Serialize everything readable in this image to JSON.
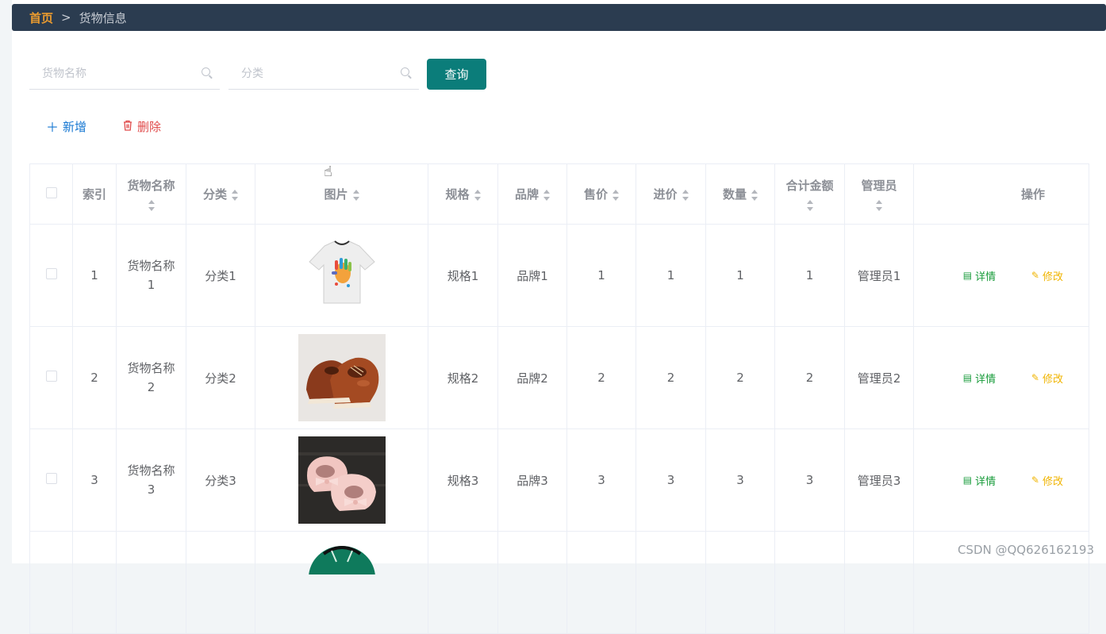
{
  "breadcrumb": {
    "home": "首页",
    "separator": ">",
    "current": "货物信息"
  },
  "search": {
    "name_placeholder": "货物名称",
    "category_placeholder": "分类",
    "query_label": "查询"
  },
  "toolbar": {
    "add_label": "新增",
    "delete_label": "删除"
  },
  "table": {
    "headers": {
      "index": "索引",
      "name": "货物名称",
      "category": "分类",
      "image": "图片",
      "spec": "规格",
      "brand": "品牌",
      "sale_price": "售价",
      "purchase_price": "进价",
      "quantity": "数量",
      "total": "合计金额",
      "admin": "管理员",
      "actions": "操作"
    },
    "rows": [
      {
        "index": "1",
        "name": "货物名称1",
        "category": "分类1",
        "image": "white-tshirt",
        "spec": "规格1",
        "brand": "品牌1",
        "sale_price": "1",
        "purchase_price": "1",
        "quantity": "1",
        "total": "1",
        "admin": "管理员1"
      },
      {
        "index": "2",
        "name": "货物名称2",
        "category": "分类2",
        "image": "brown-leather-shoes",
        "spec": "规格2",
        "brand": "品牌2",
        "sale_price": "2",
        "purchase_price": "2",
        "quantity": "2",
        "total": "2",
        "admin": "管理员2"
      },
      {
        "index": "3",
        "name": "货物名称3",
        "category": "分类3",
        "image": "pink-bow-shoes",
        "spec": "规格3",
        "brand": "品牌3",
        "sale_price": "3",
        "purchase_price": "3",
        "quantity": "3",
        "total": "3",
        "admin": "管理员3"
      }
    ],
    "detail_label": "详情",
    "edit_label": "修改"
  },
  "watermark": "CSDN @QQ626162193",
  "colors": {
    "header_bar": "#2b3c50",
    "home_link": "#e99a2f",
    "query_button": "#0b7d7a",
    "add": "#1677d2",
    "delete": "#e04b4b",
    "detail": "#1a9c3c",
    "edit": "#f0b400"
  }
}
